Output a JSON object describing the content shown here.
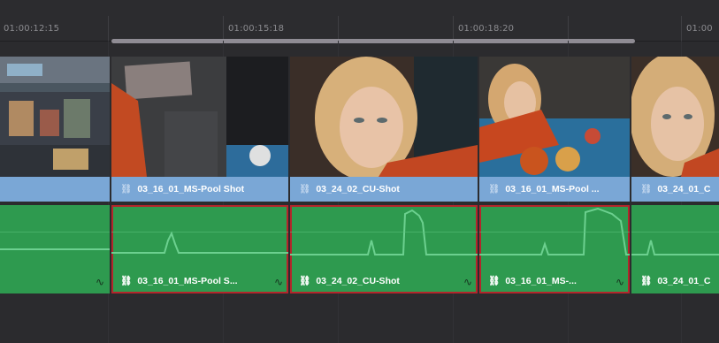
{
  "ruler": {
    "timecodes": [
      "01:00:12:15",
      "01:00:15:18",
      "01:00:18:20",
      "01:00"
    ]
  },
  "video_clips": [
    {
      "label": "",
      "selected": false
    },
    {
      "label": "03_16_01_MS-Pool Shot",
      "selected": true
    },
    {
      "label": "03_24_02_CU-Shot",
      "selected": true
    },
    {
      "label": "03_16_01_MS-Pool ...",
      "selected": true
    },
    {
      "label": "03_24_01_C",
      "selected": false
    }
  ],
  "audio_clips": [
    {
      "label": "",
      "selected": false
    },
    {
      "label": "03_16_01_MS-Pool S...",
      "selected": true
    },
    {
      "label": "03_24_02_CU-Shot",
      "selected": true
    },
    {
      "label": "03_16_01_MS-...",
      "selected": true
    },
    {
      "label": "03_24_01_C",
      "selected": false
    }
  ],
  "icons": {
    "link": "link-icon",
    "curve": "volume-curve-icon"
  },
  "colors": {
    "video_label": "#7aa7d6",
    "audio_clip": "#2e9a4f",
    "selection": "#b3262b"
  }
}
